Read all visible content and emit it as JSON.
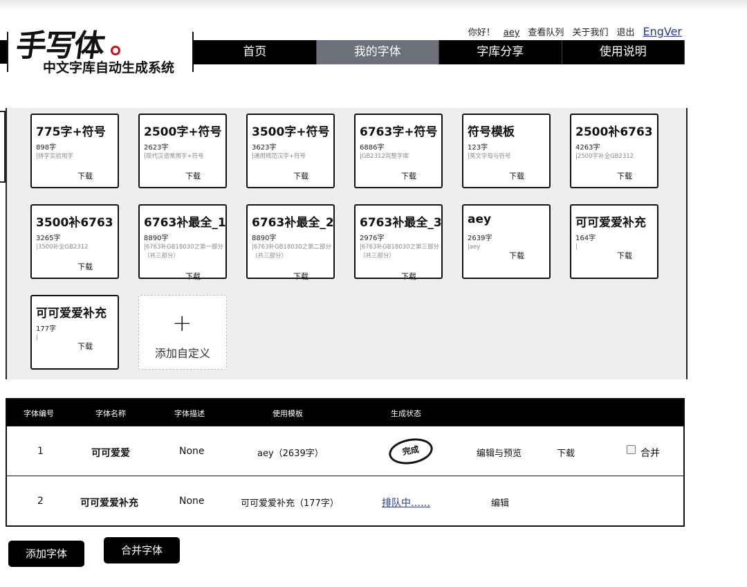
{
  "logo": {
    "big": "手写体",
    "subtitle": "中文字库自动生成系统"
  },
  "topnav": {
    "greeting": "你好！",
    "user": "aey",
    "queue": "查看队列",
    "about": "关于我们",
    "logout": "退出",
    "english": "EngVer"
  },
  "mainnav": {
    "tabs": [
      "首页",
      "我的字体",
      "字库分享",
      "使用说明"
    ],
    "active": "我的字体"
  },
  "cards": [
    {
      "title": "775字+符号",
      "count": "898字",
      "desc": "|拼字实验用字",
      "download": "下载"
    },
    {
      "title": "2500字+符号",
      "count": "2623字",
      "desc": "|现代汉语常用字+符号",
      "download": "下载"
    },
    {
      "title": "3500字+符号",
      "count": "3623字",
      "desc": "|通用规范汉字+符号",
      "download": "下载"
    },
    {
      "title": "6763字+符号",
      "count": "6886字",
      "desc": "|GB2312完整字库",
      "download": "下载"
    },
    {
      "title": "符号模板",
      "count": "123字",
      "desc": "|英文字母与符号",
      "download": "下载"
    },
    {
      "title": "2500补6763",
      "count": "4263字",
      "desc": "|2500字补全GB2312",
      "download": "下载"
    },
    {
      "title": "3500补6763",
      "count": "3265字",
      "desc": "|3500补全GB2312",
      "download": "下载"
    },
    {
      "title": "6763补最全_1",
      "count": "8890字",
      "desc": "|6763补GB18030之第一部分（共三部分）",
      "download": "下载"
    },
    {
      "title": "6763补最全_2",
      "count": "8890字",
      "desc": "|6763补GB18030之第二部分（共三部分）",
      "download": "下载"
    },
    {
      "title": "6763补最全_3",
      "count": "2976字",
      "desc": "|6763补GB18030之第三部分（共三部分）",
      "download": "下载"
    },
    {
      "title": "aey",
      "count": "2639字",
      "desc": "|aey",
      "download": "下载"
    },
    {
      "title": "可可爱爱补充",
      "count": "164字",
      "desc": "|",
      "download": "下载"
    },
    {
      "title": "可可爱爱补充",
      "count": "177字",
      "desc": "|",
      "download": "下载"
    }
  ],
  "add_card": {
    "plus": "+",
    "label": "添加自定义"
  },
  "table": {
    "headers": [
      "字体编号",
      "字体名称",
      "字体描述",
      "使用模板",
      "生成状态"
    ],
    "rows": [
      {
        "id": "1",
        "name": "可可爱爱",
        "desc": "None",
        "template": "aey（2639字）",
        "status": "完成",
        "edit": "编辑与预览",
        "download": "下载",
        "merge": "合并"
      },
      {
        "id": "2",
        "name": "可可爱爱补充",
        "desc": "None",
        "template": "可可爱爱补充（177字）",
        "status": "排队中……",
        "edit": "编辑"
      }
    ]
  },
  "buttons": {
    "add_font": "添加字体",
    "merge_font": "合并字体"
  }
}
